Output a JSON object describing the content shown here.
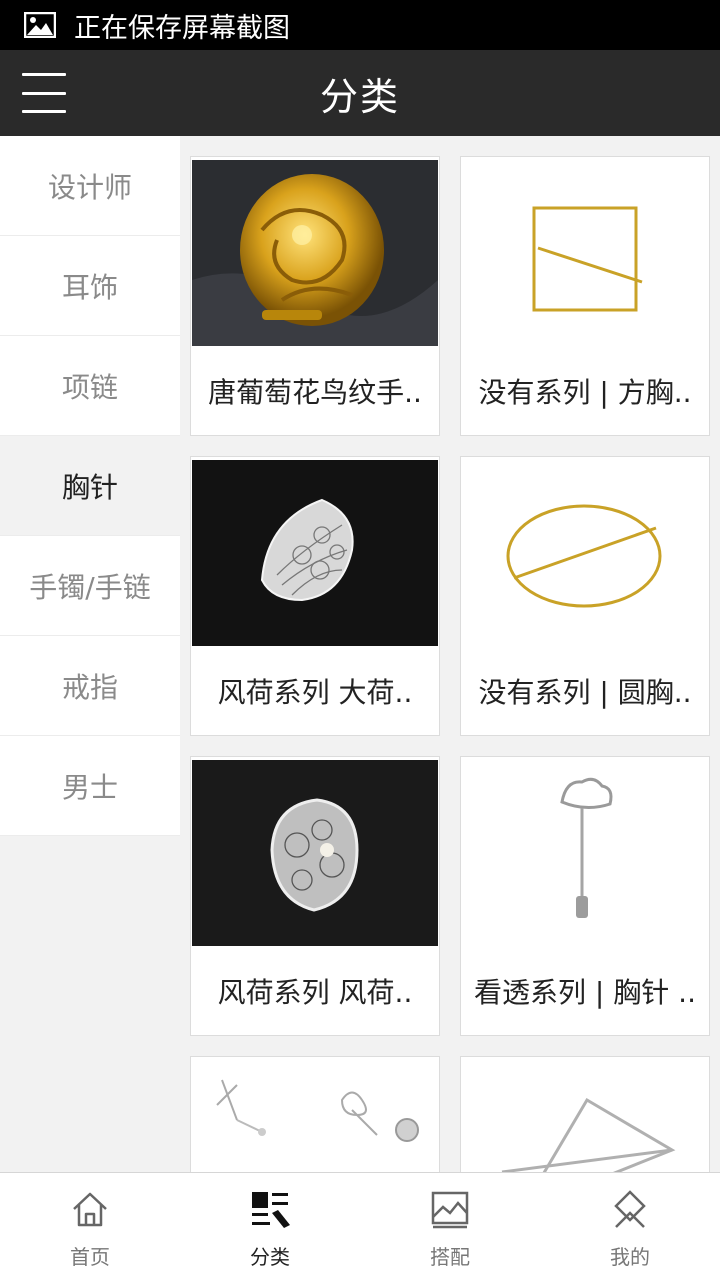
{
  "status_bar": {
    "text": "正在保存屏幕截图",
    "icon": "image-icon"
  },
  "app_bar": {
    "title": "分类",
    "menu_icon": "hamburger-menu-icon"
  },
  "sidebar": {
    "items": [
      {
        "label": "设计师",
        "active": false
      },
      {
        "label": "耳饰",
        "active": false
      },
      {
        "label": "项链",
        "active": false
      },
      {
        "label": "胸针",
        "active": true
      },
      {
        "label": "手镯/手链",
        "active": false
      },
      {
        "label": "戒指",
        "active": false
      },
      {
        "label": "男士",
        "active": false
      }
    ]
  },
  "products": [
    {
      "name": "唐葡萄花鸟纹手..",
      "image": "gold-filigree-ball-photo"
    },
    {
      "name": "没有系列 | 方胸..",
      "image": "gold-square-brooch-photo"
    },
    {
      "name": "风荷系列 大荷..",
      "image": "silver-lotus-leaf-brooch-photo"
    },
    {
      "name": "没有系列 | 圆胸..",
      "image": "gold-circle-brooch-photo"
    },
    {
      "name": "风荷系列 风荷..",
      "image": "silver-lotus-pearl-brooch-photo"
    },
    {
      "name": "看透系列 | 胸针 ..",
      "image": "silver-cloud-stick-pin-photo"
    },
    {
      "name": "",
      "image": "silver-pin-set-photo"
    },
    {
      "name": "",
      "image": "silver-triangle-brooch-photo"
    }
  ],
  "tab_bar": {
    "tabs": [
      {
        "label": "首页",
        "icon": "home-icon",
        "active": false
      },
      {
        "label": "分类",
        "icon": "category-icon",
        "active": true
      },
      {
        "label": "搭配",
        "icon": "picture-frame-icon",
        "active": false
      },
      {
        "label": "我的",
        "icon": "user-diamond-icon",
        "active": false
      }
    ]
  },
  "colors": {
    "app_bar": "#2a2a2a",
    "status_bar": "#000000",
    "background": "#f2f2f2",
    "active_text": "#222222",
    "inactive_text": "#8a8a8a"
  }
}
